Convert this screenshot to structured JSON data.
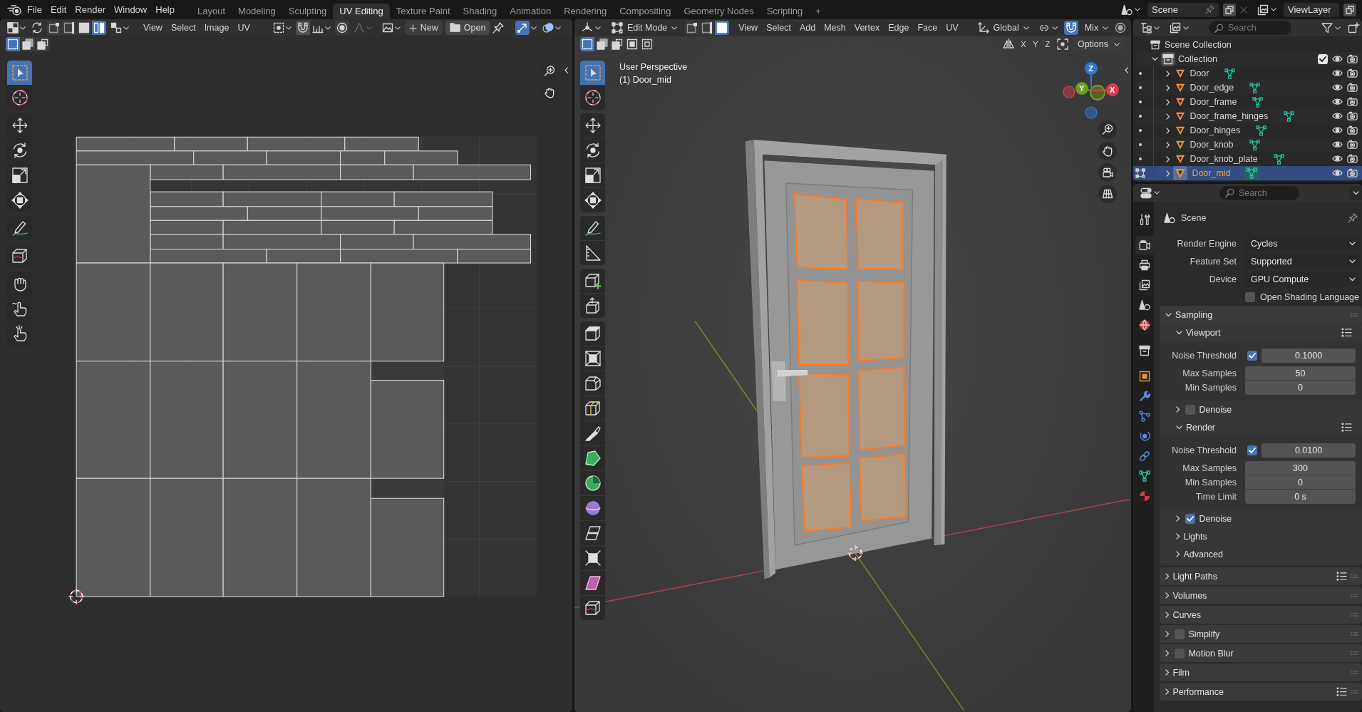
{
  "top_bar": {
    "menus": [
      "File",
      "Edit",
      "Render",
      "Window",
      "Help"
    ],
    "workspaces": [
      {
        "label": "Layout",
        "selected": false
      },
      {
        "label": "Modeling",
        "selected": false
      },
      {
        "label": "Sculpting",
        "selected": false
      },
      {
        "label": "UV Editing",
        "selected": true
      },
      {
        "label": "Texture Paint",
        "selected": false
      },
      {
        "label": "Shading",
        "selected": false
      },
      {
        "label": "Animation",
        "selected": false
      },
      {
        "label": "Rendering",
        "selected": false
      },
      {
        "label": "Compositing",
        "selected": false
      },
      {
        "label": "Geometry Nodes",
        "selected": false
      },
      {
        "label": "Scripting",
        "selected": false
      }
    ],
    "add_workspace": "+",
    "scene": "Scene",
    "view_layer": "ViewLayer"
  },
  "uv_editor": {
    "select_modes": [
      {
        "kind": "vertex",
        "selected": false
      },
      {
        "kind": "edge",
        "selected": false
      },
      {
        "kind": "face",
        "selected": false
      },
      {
        "kind": "island",
        "selected": true
      }
    ],
    "menus": [
      "View",
      "Select",
      "Image",
      "UV"
    ],
    "new_button": "New",
    "open_button": "Open",
    "selection_ops": [
      {
        "kind": "set",
        "selected": true
      },
      {
        "kind": "extend",
        "selected": false
      },
      {
        "kind": "subtract",
        "selected": false
      }
    ],
    "tool_groups": [
      [
        {
          "kind": "select_box",
          "selected": true
        },
        {
          "kind": "cursor",
          "selected": false
        }
      ],
      [
        {
          "kind": "move",
          "selected": false
        },
        {
          "kind": "rotate",
          "selected": false
        },
        {
          "kind": "scale",
          "selected": false
        },
        {
          "kind": "transform",
          "selected": false
        }
      ],
      [
        {
          "kind": "annotate",
          "selected": false
        }
      ],
      [
        {
          "kind": "rip",
          "selected": false
        }
      ],
      [
        {
          "kind": "grab",
          "selected": false
        },
        {
          "kind": "relax",
          "selected": false
        },
        {
          "kind": "pinch",
          "selected": false
        }
      ]
    ]
  },
  "viewport": {
    "mode": "Edit Mode",
    "select_modes": [
      {
        "kind": "vertex",
        "selected": false
      },
      {
        "kind": "edge",
        "selected": false
      },
      {
        "kind": "face",
        "selected": true
      }
    ],
    "menus": [
      "View",
      "Select",
      "Add",
      "Mesh",
      "Vertex",
      "Edge",
      "Face",
      "UV"
    ],
    "orientation": "Global",
    "snapping": true,
    "snap_elements": "Mix",
    "selection_ops": [
      {
        "kind": "set",
        "selected": true
      },
      {
        "kind": "extend",
        "selected": false
      },
      {
        "kind": "subtract",
        "selected": false
      },
      {
        "kind": "invert",
        "selected": false
      },
      {
        "kind": "intersect",
        "selected": false
      }
    ],
    "mirror_axes": [
      "X",
      "Y",
      "Z"
    ],
    "options": "Options",
    "view_name": "User Perspective",
    "active_object": "(1) Door_mid",
    "gizmo_axes": [
      {
        "label": "Z",
        "color": "#2f79d6"
      },
      {
        "label": "Y",
        "color": "#6b9e23"
      },
      {
        "label": "X",
        "color": "#e03c52"
      }
    ],
    "tool_groups": [
      [
        {
          "kind": "select_box",
          "selected": true
        },
        {
          "kind": "cursor",
          "selected": false
        }
      ],
      [
        {
          "kind": "move",
          "selected": false
        },
        {
          "kind": "rotate",
          "selected": false
        },
        {
          "kind": "scale",
          "selected": false
        },
        {
          "kind": "transform",
          "selected": false
        }
      ],
      [
        {
          "kind": "annotate",
          "selected": false
        },
        {
          "kind": "measure",
          "selected": false
        }
      ],
      [
        {
          "kind": "add_cube",
          "selected": false
        },
        {
          "kind": "extrude_arrow",
          "selected": false
        }
      ],
      [
        {
          "kind": "extrude",
          "selected": false
        },
        {
          "kind": "inset",
          "selected": false
        },
        {
          "kind": "bevel",
          "selected": false
        },
        {
          "kind": "loop_cut",
          "selected": false
        },
        {
          "kind": "knife",
          "selected": false
        },
        {
          "kind": "poly_build",
          "selected": false
        },
        {
          "kind": "spin",
          "selected": false
        },
        {
          "kind": "smooth",
          "selected": false
        },
        {
          "kind": "edge_slide",
          "selected": false
        },
        {
          "kind": "shrink",
          "selected": false
        },
        {
          "kind": "shear",
          "selected": false
        },
        {
          "kind": "rip",
          "selected": false
        }
      ]
    ]
  },
  "outliner": {
    "search": {
      "placeholder": "Search"
    },
    "scene_collection": "Scene Collection",
    "collection": {
      "name": "Collection",
      "expanded": true,
      "checked": true,
      "children": [
        {
          "name": "Door",
          "selected": false,
          "expanded": false
        },
        {
          "name": "Door_edge",
          "selected": false,
          "expanded": false
        },
        {
          "name": "Door_frame",
          "selected": false,
          "expanded": false
        },
        {
          "name": "Door_frame_hinges",
          "selected": false,
          "expanded": false
        },
        {
          "name": "Door_hinges",
          "selected": false,
          "expanded": false
        },
        {
          "name": "Door_knob",
          "selected": false,
          "expanded": false
        },
        {
          "name": "Door_knob_plate",
          "selected": false,
          "expanded": false
        },
        {
          "name": "Door_mid",
          "selected": true,
          "expanded": false
        }
      ]
    }
  },
  "properties": {
    "search": {
      "placeholder": "Search"
    },
    "tabs": [
      [
        {
          "kind": "tool",
          "selected": false
        }
      ],
      [
        {
          "kind": "render",
          "selected": true
        },
        {
          "kind": "output",
          "selected": false
        },
        {
          "kind": "view_layer",
          "selected": false
        },
        {
          "kind": "scene",
          "selected": false
        },
        {
          "kind": "world",
          "selected": false
        }
      ],
      [
        {
          "kind": "collection",
          "selected": false
        }
      ],
      [
        {
          "kind": "object",
          "selected": false
        },
        {
          "kind": "modifiers",
          "selected": false
        },
        {
          "kind": "particles",
          "selected": false
        },
        {
          "kind": "physics",
          "selected": false
        },
        {
          "kind": "constraints",
          "selected": false
        },
        {
          "kind": "data",
          "selected": false
        },
        {
          "kind": "material",
          "selected": false
        }
      ]
    ],
    "context": "Scene",
    "settings": [
      {
        "kind": "dropdown",
        "label": "Render Engine",
        "value": "Cycles"
      },
      {
        "kind": "dropdown",
        "label": "Feature Set",
        "value": "Supported"
      },
      {
        "kind": "dropdown",
        "label": "Device",
        "value": "GPU Compute"
      },
      {
        "kind": "checkbox",
        "label": "Open Shading Language",
        "checked": false
      }
    ],
    "panels": [
      {
        "title": "Sampling",
        "expanded": true,
        "subpanels": [
          {
            "title": "Viewport",
            "expanded": true,
            "presets": true,
            "rows": [
              {
                "kind": "toggle_number",
                "label": "Noise Threshold",
                "checked": true,
                "value": "0.1000"
              },
              {
                "kind": "number",
                "label": "Max Samples",
                "value": "50"
              },
              {
                "kind": "number",
                "label": "Min Samples",
                "value": "0"
              }
            ]
          },
          {
            "title": "Denoise",
            "expanded": false,
            "checked": false
          },
          {
            "title": "Render",
            "expanded": true,
            "presets": true,
            "rows": [
              {
                "kind": "toggle_number",
                "label": "Noise Threshold",
                "checked": true,
                "value": "0.0100"
              },
              {
                "kind": "number",
                "label": "Max Samples",
                "value": "300"
              },
              {
                "kind": "number",
                "label": "Min Samples",
                "value": "0"
              },
              {
                "kind": "number",
                "label": "Time Limit",
                "value": "0 s"
              }
            ]
          },
          {
            "title": "Denoise",
            "expanded": false,
            "checked": true
          },
          {
            "title": "Lights",
            "expanded": false
          },
          {
            "title": "Advanced",
            "expanded": false
          }
        ]
      },
      {
        "title": "Light Paths",
        "expanded": false,
        "presets": true
      },
      {
        "title": "Volumes",
        "expanded": false
      },
      {
        "title": "Curves",
        "expanded": false
      },
      {
        "title": "Simplify",
        "expanded": false,
        "checked": false
      },
      {
        "title": "Motion Blur",
        "expanded": false,
        "checked": false
      },
      {
        "title": "Film",
        "expanded": false
      },
      {
        "title": "Performance",
        "expanded": false,
        "presets": true
      }
    ]
  }
}
